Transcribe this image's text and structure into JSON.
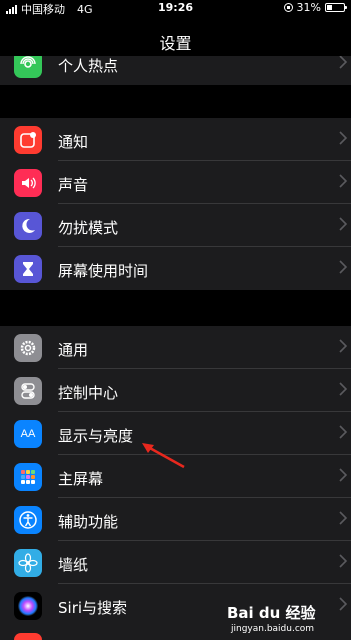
{
  "status_bar": {
    "carrier": "中国移动",
    "network": "4G",
    "time": "19:26",
    "battery_text": "31%",
    "battery_level": 0.31
  },
  "header": {
    "title": "设置"
  },
  "sections": [
    {
      "items": [
        {
          "label": "个人热点",
          "icon": "hotspot-icon",
          "color": "#34c759"
        }
      ]
    },
    {
      "items": [
        {
          "label": "通知",
          "icon": "notifications-icon",
          "color": "#ff3b30"
        },
        {
          "label": "声音",
          "icon": "sounds-icon",
          "color": "#ff2d55"
        },
        {
          "label": "勿扰模式",
          "icon": "moon-icon",
          "color": "#5856d6"
        },
        {
          "label": "屏幕使用时间",
          "icon": "hourglass-icon",
          "color": "#5856d6"
        }
      ]
    },
    {
      "items": [
        {
          "label": "通用",
          "icon": "gear-icon",
          "color": "#8e8e93"
        },
        {
          "label": "控制中心",
          "icon": "toggles-icon",
          "color": "#8e8e93"
        },
        {
          "label": "显示与亮度",
          "icon": "display-icon",
          "color": "#0a84ff"
        },
        {
          "label": "主屏幕",
          "icon": "home-grid-icon",
          "color": "#0a84ff"
        },
        {
          "label": "辅助功能",
          "icon": "accessibility-icon",
          "color": "#0a84ff"
        },
        {
          "label": "墙纸",
          "icon": "flower-icon",
          "color": "#32ade6"
        },
        {
          "label": "Siri与搜索",
          "icon": "siri-icon",
          "color": "#1c1c1e"
        }
      ]
    }
  ],
  "annotation": {
    "icon": "red-arrow-icon",
    "color": "#e8281e"
  },
  "watermark": {
    "logo": "Bai du 经验",
    "site": "jingyan.baidu.com"
  }
}
